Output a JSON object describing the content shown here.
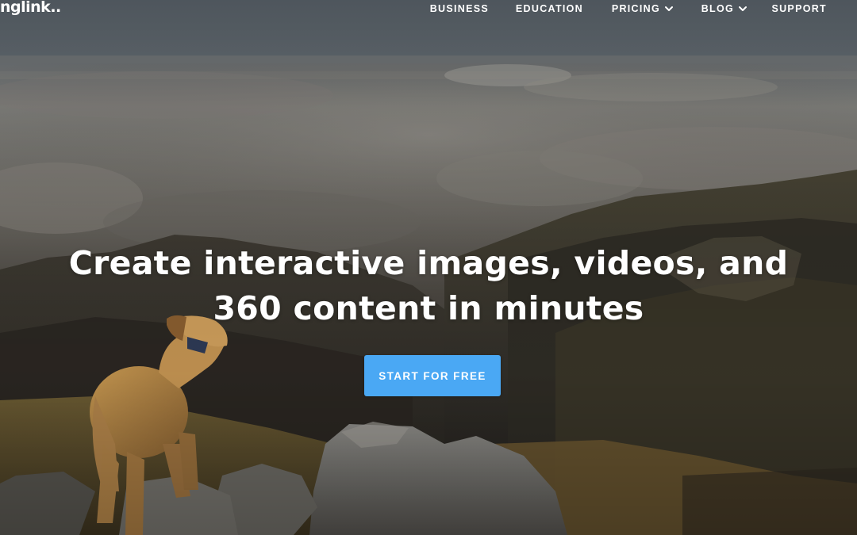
{
  "brand": {
    "logo_text": "nglink.."
  },
  "nav": {
    "items": [
      {
        "label": "BUSINESS",
        "has_dropdown": false
      },
      {
        "label": "EDUCATION",
        "has_dropdown": false
      },
      {
        "label": "PRICING",
        "has_dropdown": true
      },
      {
        "label": "BLOG",
        "has_dropdown": true
      },
      {
        "label": "SUPPORT",
        "has_dropdown": false
      }
    ]
  },
  "hero": {
    "headline_line1": "Create interactive images, videos, and",
    "headline_line2": "360 content in minutes",
    "cta_label": "START FOR FREE"
  },
  "colors": {
    "cta_background": "#4aa8f4",
    "text": "#ffffff"
  },
  "icons": {
    "dropdown": "chevron-down-icon"
  }
}
